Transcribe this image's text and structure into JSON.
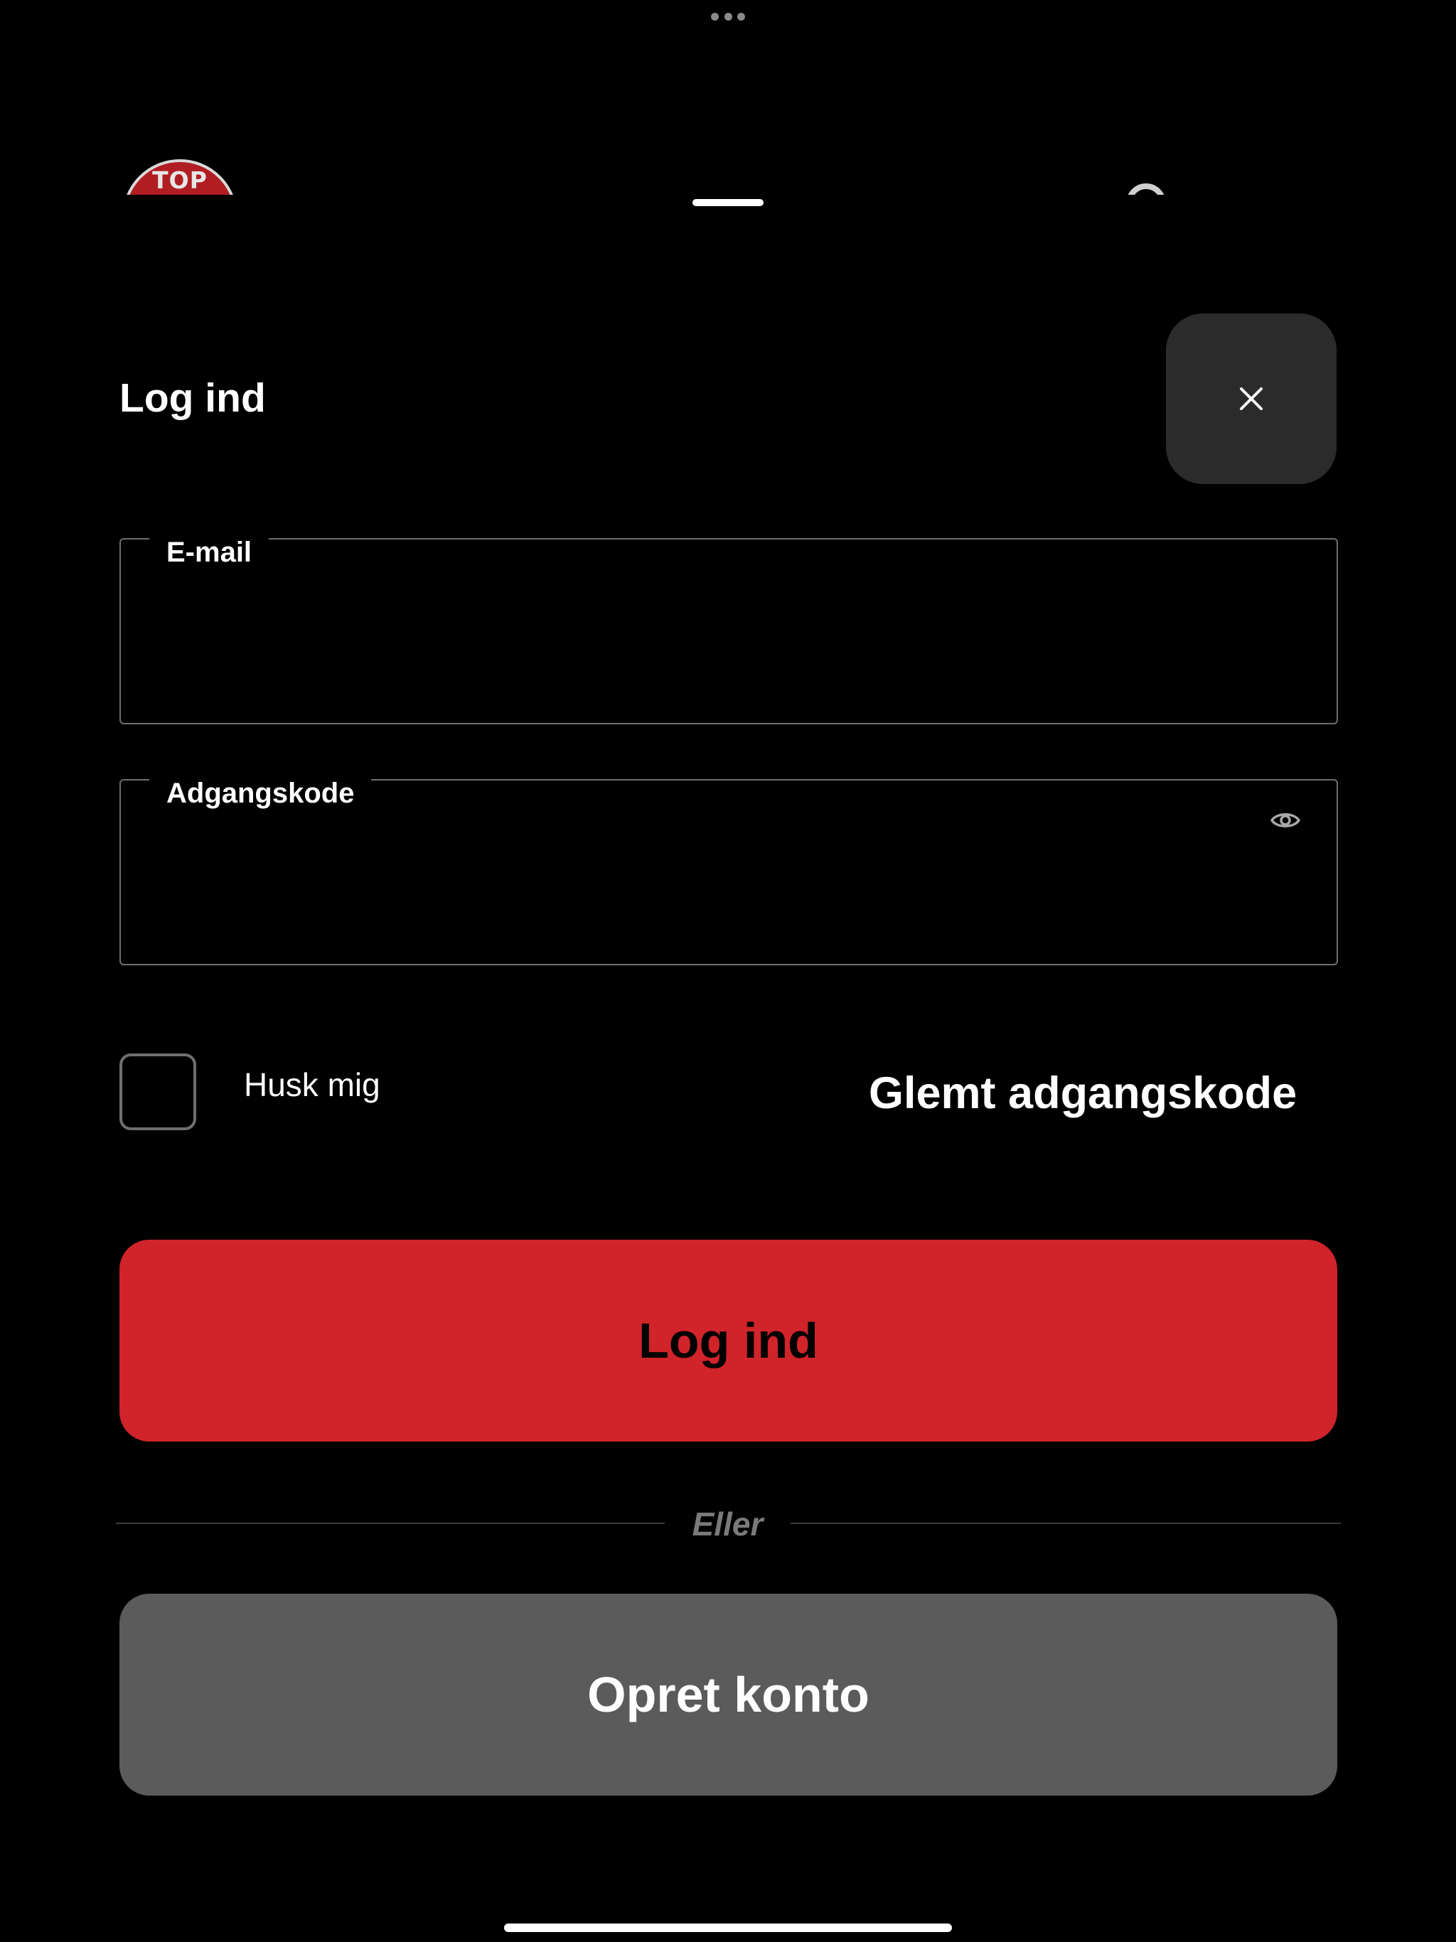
{
  "header": {
    "logo_text": "TOP"
  },
  "sheet": {
    "title": "Log ind",
    "close_icon": "close-icon"
  },
  "form": {
    "email_label": "E-mail",
    "email_value": "",
    "password_label": "Adgangskode",
    "password_value": "",
    "password_toggle_icon": "eye-icon",
    "remember_label": "Husk mig",
    "remember_checked": false,
    "forgot_link": "Glemt adgangskode"
  },
  "actions": {
    "login_label": "Log ind",
    "divider_text": "Eller",
    "create_account_label": "Opret konto"
  },
  "colors": {
    "background": "#000000",
    "primary_button": "#d0232a",
    "secondary_button": "#5b5b5b",
    "close_button": "#2b2b2b"
  }
}
